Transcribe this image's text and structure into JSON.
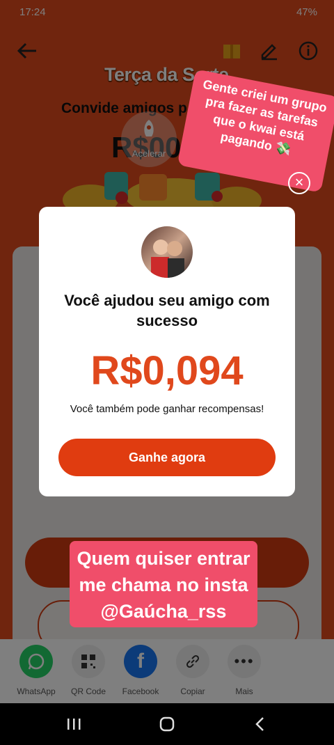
{
  "status_bar": {
    "time": "17:24",
    "battery": "47%"
  },
  "banner": {
    "title": "Terça da Sorte",
    "invite_text": "Convide amigos p",
    "amount_partial": "R$00",
    "accelerate_label": "Acelerar"
  },
  "sticker_top": {
    "lines": [
      "Gente criei um grupo",
      "pra fazer as tarefas",
      "que o kwai está",
      "pagando 💸"
    ]
  },
  "modal": {
    "title": "Você ajudou seu amigo com sucesso",
    "amount": "R$0,094",
    "subtitle": "Você também pode ganhar recompensas!",
    "button_label": "Ganhe agora",
    "close_symbol": "×"
  },
  "sticker_bottom": {
    "lines": [
      "Quem quiser entrar",
      "me chama no insta",
      "@Gaúcha_rss"
    ]
  },
  "share": {
    "items": [
      {
        "label": "WhatsApp",
        "icon": "whatsapp-icon",
        "color": "#25d366"
      },
      {
        "label": "QR Code",
        "icon": "qr-code-icon",
        "color": "#eeeeee"
      },
      {
        "label": "Facebook",
        "icon": "facebook-icon",
        "color": "#1877f2"
      },
      {
        "label": "Copiar",
        "icon": "link-icon",
        "color": "#eeeeee"
      },
      {
        "label": "Mais",
        "icon": "more-icon",
        "color": "#eeeeee"
      }
    ]
  },
  "colors": {
    "accent": "#e0481c",
    "sticker": "#f04e6a",
    "background": "#e04a1c"
  }
}
